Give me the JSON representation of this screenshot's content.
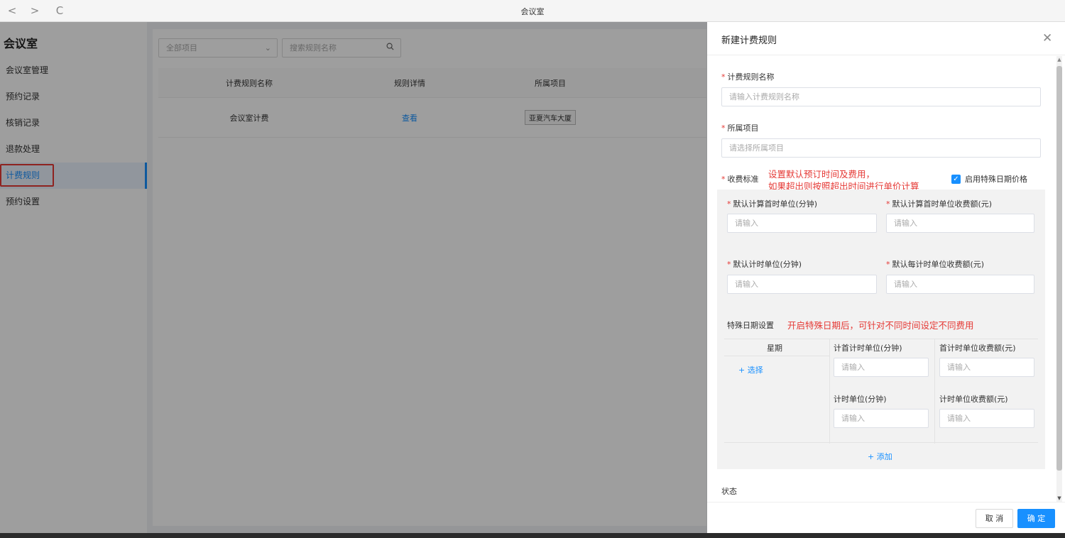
{
  "browser": {
    "back": "<",
    "forward": ">",
    "refresh": "C",
    "title": "会议室"
  },
  "sidebar": {
    "title": "会议室",
    "items": [
      {
        "label": "会议室管理"
      },
      {
        "label": "预约记录"
      },
      {
        "label": "核销记录"
      },
      {
        "label": "退款处理"
      },
      {
        "label": "计费规则",
        "active": true
      },
      {
        "label": "预约设置"
      }
    ]
  },
  "main": {
    "filter": {
      "project_select": "全部项目",
      "search_placeholder": "搜索规则名称"
    },
    "table": {
      "headers": [
        "计费规则名称",
        "规则详情",
        "所属项目"
      ],
      "rows": [
        {
          "name": "会议室计费",
          "detail": "查看",
          "project": "亚夏汽车大厦"
        }
      ]
    }
  },
  "drawer": {
    "title": "新建计费规则",
    "rule_name": {
      "label": "计费规则名称",
      "placeholder": "请输入计费规则名称"
    },
    "project": {
      "label": "所属项目",
      "placeholder": "请选择所属项目"
    },
    "fee_standard": {
      "label": "收费标准",
      "note_line1": "设置默认预订时间及费用，",
      "note_line2": "如果超出则按照超出时间进行单价计算",
      "special_checkbox_label": "启用特殊日期价格",
      "special_checked": true,
      "default_first_unit": {
        "label": "默认计算首时单位(分钟)",
        "placeholder": "请输入"
      },
      "default_first_fee": {
        "label": "默认计算首时单位收费额(元)",
        "placeholder": "请输入"
      },
      "default_unit": {
        "label": "默认计时单位(分钟)",
        "placeholder": "请输入"
      },
      "default_unit_fee": {
        "label": "默认每计时单位收费额(元)",
        "placeholder": "请输入"
      }
    },
    "special": {
      "label": "特殊日期设置",
      "note": "开启特殊日期后，可针对不同时间设定不同费用",
      "week_header": "星期",
      "select_link": "+ 选择",
      "first_unit": {
        "label": "计首计时单位(分钟)",
        "placeholder": "请输入"
      },
      "first_fee": {
        "label": "首计时单位收费额(元)",
        "placeholder": "请输入"
      },
      "unit": {
        "label": "计时单位(分钟)",
        "placeholder": "请输入"
      },
      "unit_fee": {
        "label": "计时单位收费额(元)",
        "placeholder": "请输入"
      },
      "add_link": "+ 添加"
    },
    "status_label": "状态",
    "footer": {
      "cancel": "取 消",
      "ok": "确 定"
    }
  },
  "colors": {
    "primary": "#1890ff",
    "annotation_red": "#e53935"
  }
}
